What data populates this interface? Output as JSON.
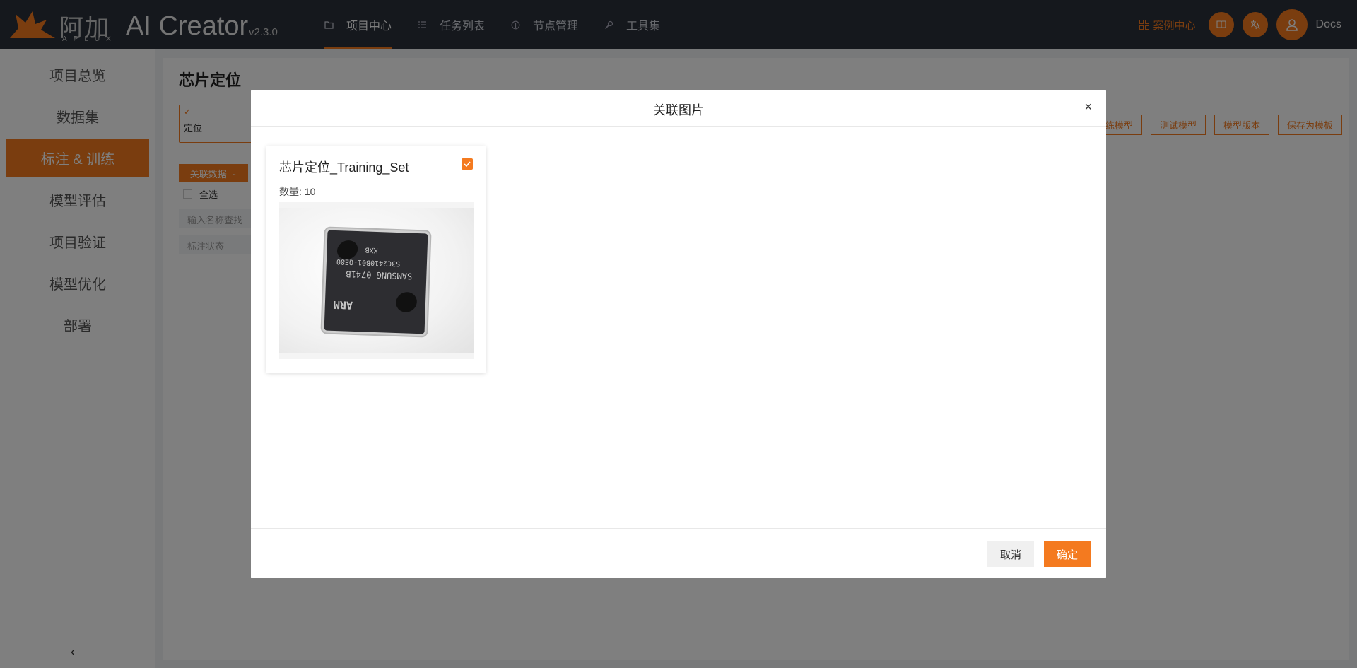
{
  "header": {
    "logo_cn": "阿加犀",
    "logo_en": "APLUX",
    "app_title": "AI Creator",
    "version": "v2.3.0",
    "nav": [
      {
        "label": "项目中心",
        "icon": "folder-icon",
        "active": true
      },
      {
        "label": "任务列表",
        "icon": "list-icon",
        "active": false
      },
      {
        "label": "节点管理",
        "icon": "node-icon",
        "active": false
      },
      {
        "label": "工具集",
        "icon": "wrench-icon",
        "active": false
      }
    ],
    "case_center": "案例中心",
    "docs": "Docs"
  },
  "sidebar": {
    "items": [
      {
        "label": "项目总览"
      },
      {
        "label": "数据集"
      },
      {
        "label": "标注 & 训练",
        "active": true
      },
      {
        "label": "模型评估"
      },
      {
        "label": "项目验证"
      },
      {
        "label": "模型优化"
      },
      {
        "label": "部署"
      }
    ],
    "collapse_icon": "chevron-left-icon"
  },
  "main": {
    "title": "芯片定位",
    "step_label": "定位",
    "action_buttons": [
      "训练模型",
      "测试模型",
      "模型版本",
      "保存为模板"
    ],
    "link_data_label": "关联数据",
    "select_all": "全选",
    "search_placeholder": "输入名称查找",
    "status_placeholder": "标注状态"
  },
  "modal": {
    "title": "关联图片",
    "close": "×",
    "cancel": "取消",
    "ok": "确定",
    "dataset": {
      "name": "芯片定位_Training_Set",
      "count_label": "数量:",
      "count": "10",
      "checked": true,
      "chip_text_1": "ARM",
      "chip_text_2": "SAMSUNG  0741B",
      "chip_text_3": "S3C2410B01-QE80",
      "chip_text_4": "KXB"
    }
  },
  "colors": {
    "accent": "#f47a1f",
    "topbar": "#2b303b"
  }
}
